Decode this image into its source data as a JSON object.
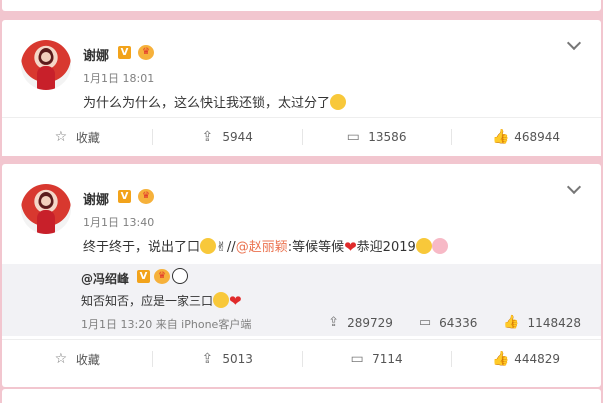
{
  "posts": [
    {
      "user": "谢娜",
      "time": "1月1日 18:01",
      "text": "为什么为什么，这么快让我还锁，太过分了",
      "actions": {
        "collect": "收藏",
        "repost": "5944",
        "comment": "13586",
        "like": "468944"
      }
    },
    {
      "user": "谢娜",
      "time": "1月1日 13:40",
      "text_before": "终于终于，说出了口",
      "text_sep": "//",
      "mention": "@赵丽颖",
      "text_after": ":等候等候",
      "text_tail": "恭迎2019",
      "repost": {
        "user": "@冯绍峰",
        "text": "知否知否，应是一家三口",
        "time": "1月1日 13:20 来自 iPhone客户端",
        "repost_count": "289729",
        "comment_count": "64336",
        "like_count": "1148428"
      },
      "actions": {
        "collect": "收藏",
        "repost": "5013",
        "comment": "7114",
        "like": "444829"
      }
    }
  ],
  "badges": {
    "verified": "V",
    "vip": "♛"
  },
  "colors": {
    "background": "#f2c6cf",
    "mention": "#eb7350",
    "verified": "#f2a31b"
  }
}
